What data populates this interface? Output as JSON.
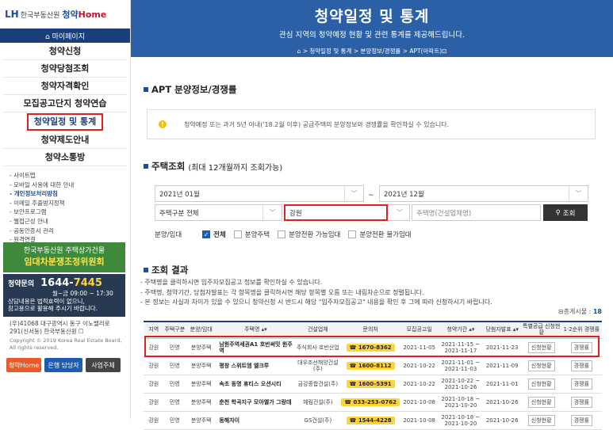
{
  "brand": {
    "logo_mark": "LH",
    "org": "한국부동산원",
    "app": "청약",
    "app_home": "Home"
  },
  "sidebar": {
    "mypage": "⌂ 마이페이지",
    "menu": [
      "청약신청",
      "청약당첨조회",
      "청약자격확인",
      "모집공고단지 청약연습",
      "청약일정 및 통계",
      "청약제도안내",
      "청약소통방"
    ],
    "active_index": 4,
    "links": [
      "- 사이트맵",
      "- 모바일 사용에 대한 안내",
      "- 개인정보처리방침",
      "- 이메일 추출방지정책",
      "- 보안프로그램",
      "- 웹접근성 안내",
      "- 공동인증서 관리",
      "- 원격연결"
    ],
    "banner_line1": "한국부동산원 주택상가건물",
    "banner_line2": "임대차분쟁조정위원회",
    "phone_label": "청약문의",
    "phone_prefix": "1644-",
    "phone_suffix": "7445",
    "hours": "월~금 09:00 ~ 17:30",
    "note1": "상담내용은 법적효력이 없으니,",
    "note2": "참고용으로 활용해 주시기 바랍니다.",
    "addr1": "(우)41068 대구광역시 동구 이노밸리로",
    "addr2": "291(신서동) 한국부동산원 ☐",
    "copy1": "Copyright © 2019 Korea Real Estate Board,",
    "copy2": "All rights reserved.",
    "btn1": "청약Home",
    "btn2": "은행 담당자",
    "btn3": "사업주체"
  },
  "header": {
    "title": "청약일정 및 통계",
    "subtitle": "관심 지역의 청약예정 현황 및 관련 통계를 제공해드립니다.",
    "breadcrumb": "⌂  >  청약일정 및 통계  >  분양정보/경쟁률  >  APT(아파트)⊡"
  },
  "section1": {
    "title": "APT 분양정보/경쟁률"
  },
  "info": "청약예정 또는 과거 5년 이내('18.2월 이후) 공급주택의 분양정보와 경쟁률을 확인하실 수 있습니다.",
  "section2": {
    "title": "주택조회",
    "sub": "(최대 12개월까지 조회가능)"
  },
  "filters": {
    "from": "2021년 01월",
    "to": "2021년 12월",
    "tilde": "~",
    "type": "주택구분 전체",
    "region": "강원",
    "name_placeholder": "주택명(건설업체명)",
    "search": "조회",
    "sale_label": "분양/임대",
    "opts": [
      "전체",
      "분양주택",
      "분양전환 가능임대",
      "분양전환 불가임대"
    ]
  },
  "section3": {
    "title": "조회 결과"
  },
  "notes": [
    "- 주택명을 클릭하시면 입주자모집공고 정보를 확인하실 수 있습니다.",
    "- 주택명, 청약기간, 당첨자발표는 각 항목명을 클릭하시면 해당 항목별 오름 또는 내림차순으로 정렬됩니다.",
    "- 본 정보는 사실과 차이가 있을 수 있으니 청약신청 시 반드시 해당 \"입주자모집공고\" 내용을 확인 후 그에 따라 신청하시기 바랍니다."
  ],
  "count_label": "⊟총게시물 :",
  "count_value": "18",
  "table": {
    "headers": [
      "지역",
      "주택구분",
      "분양/임대",
      "주택명 ▴▾",
      "건설업체",
      "문의처",
      "모집공고일",
      "청약기간 ▴▾",
      "당첨자발표 ▴▾",
      "특별공급 신청현황",
      "1·2순위 경쟁률"
    ],
    "rows": [
      [
        "강원",
        "민영",
        "분양주택",
        "남원주역세권A1 호반써밋 원주역",
        "주식회사 호반산업",
        "☎ 1670-8362",
        "2021-11-05",
        "2021-11-15 ~ 2021-11-17",
        "2021-11-23",
        "신청현황",
        "경쟁률"
      ],
      [
        "강원",
        "민영",
        "분양주택",
        "평창 스위트엠 엘크루",
        "대우조선해양건설(주)",
        "☎ 1600-8112",
        "2021-10-22",
        "2021-11-01 ~ 2021-11-03",
        "2021-11-09",
        "신청현황",
        "경쟁률"
      ],
      [
        "강원",
        "민영",
        "분양주택",
        "속초 동명 휴티스 오션시티",
        "금강종합건설(주)",
        "☎ 1600-5391",
        "2021-10-22",
        "2021-10-22 ~ 2021-10-26",
        "2021-11-01",
        "신청현황",
        "경쟁률"
      ],
      [
        "강원",
        "민영",
        "분양주택",
        "춘천 학곡지구 모아엘가 그랑데",
        "혜림건설(주)",
        "☎ 033-253-0762",
        "2021-10-08",
        "2021-10-18 ~ 2021-10-20",
        "2021-10-26",
        "신청현황",
        "경쟁률"
      ],
      [
        "강원",
        "민영",
        "분양주택",
        "동해자이",
        "GS건설(주)",
        "☎ 1544-4228",
        "2021-10-08",
        "2021-10-18 ~ 2021-10-20",
        "2021-10-26",
        "신청현황",
        "경쟁률"
      ]
    ]
  },
  "colors": {
    "header_bg": "#2b5fa6",
    "highlight": "#e02020",
    "accent": "#1d4e9e"
  }
}
